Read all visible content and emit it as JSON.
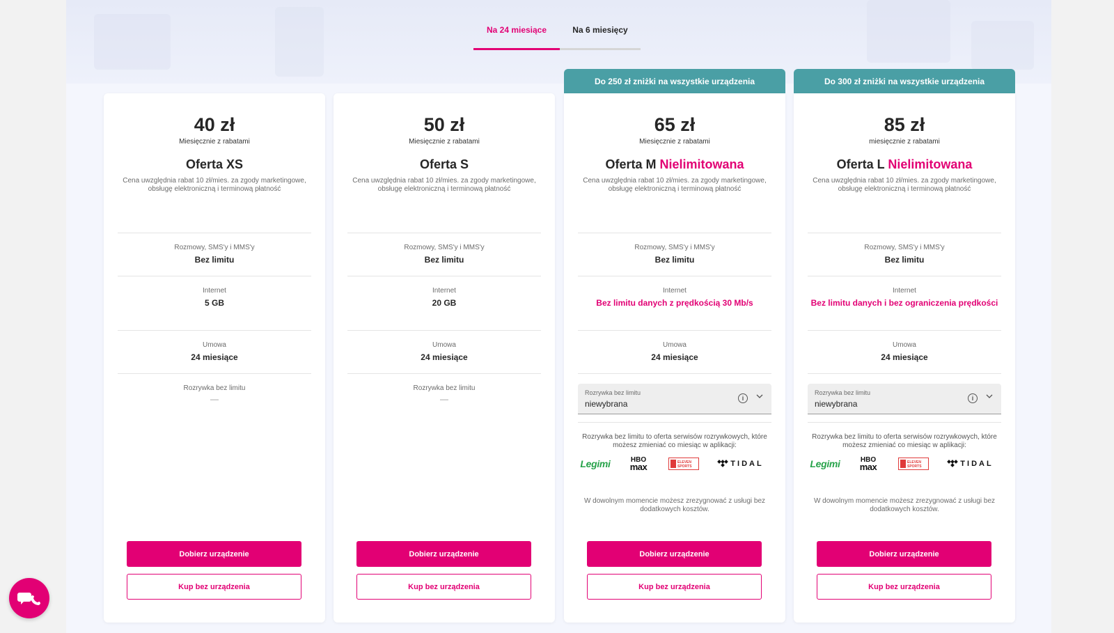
{
  "tabs": [
    {
      "label": "Na 24 miesiące",
      "active": true
    },
    {
      "label": "Na 6 miesięcy",
      "active": false
    }
  ],
  "colors": {
    "accent": "#e20074",
    "promo": "#4a9fa5"
  },
  "plans": [
    {
      "promo": "",
      "price": "40 zł",
      "price_sub": "Miesięcznie z rabatami",
      "name": "Oferta XS",
      "name_accent": "",
      "desc": "Cena uwzględnia rabat 10 zł/mies. za zgody marketingowe, obsługę elektroniczną i terminową płatność",
      "calls_label": "Rozmowy, SMS'y i MMS'y",
      "calls_value": "Bez limitu",
      "internet_label": "Internet",
      "internet_value": "5 GB",
      "contract_label": "Umowa",
      "contract_value": "24 miesiące",
      "entertainment_label": "Rozrywka bez limitu",
      "entertainment_value": "—",
      "primary_button": "Dobierz urządzenie",
      "secondary_button": "Kup bez urządzenia"
    },
    {
      "promo": "",
      "price": "50 zł",
      "price_sub": "Miesięcznie z rabatami",
      "name": "Oferta S",
      "name_accent": "",
      "desc": "Cena uwzględnia rabat 10 zł/mies. za zgody marketingowe, obsługę elektroniczną i terminową płatność",
      "calls_label": "Rozmowy, SMS'y i MMS'y",
      "calls_value": "Bez limitu",
      "internet_label": "Internet",
      "internet_value": "20 GB",
      "contract_label": "Umowa",
      "contract_value": "24 miesiące",
      "entertainment_label": "Rozrywka bez limitu",
      "entertainment_value": "—",
      "primary_button": "Dobierz urządzenie",
      "secondary_button": "Kup bez urządzenia"
    },
    {
      "promo": "Do 250 zł zniżki na wszystkie urządzenia",
      "price": "65 zł",
      "price_sub": "Miesięcznie z rabatami",
      "name": "Oferta M",
      "name_accent": "Nielimitowana",
      "desc": "Cena uwzględnia rabat 10 zł/mies. za zgody marketingowe, obsługę elektroniczną i terminową płatność",
      "calls_label": "Rozmowy, SMS'y i MMS'y",
      "calls_value": "Bez limitu",
      "internet_label": "Internet",
      "internet_value": "Bez limitu danych z prędkością 30 Mb/s",
      "contract_label": "Umowa",
      "contract_value": "24 miesiące",
      "select_label": "Rozrywka bez limitu",
      "select_value": "niewybrana",
      "ent_desc": "Rozrywka bez limitu to oferta serwisów rozrywkowych, które możesz zmieniać co miesiąc w aplikacji:",
      "logos": {
        "legimi": "Legimi",
        "hbo_top": "HBO",
        "hbo_bottom": "max",
        "eleven_top": "ELEVEN",
        "eleven_bottom": "SPORTS",
        "tidal": "TIDAL"
      },
      "cancel_note": "W dowolnym momencie możesz zrezygnować z usługi bez dodatkowych kosztów.",
      "primary_button": "Dobierz urządzenie",
      "secondary_button": "Kup bez urządzenia"
    },
    {
      "promo": "Do 300 zł zniżki na wszystkie urządzenia",
      "price": "85 zł",
      "price_sub": "miesięcznie z rabatami",
      "name": "Oferta L",
      "name_accent": "Nielimitowana",
      "desc": "Cena uwzględnia rabat 10 zł/mies. za zgody marketingowe, obsługę elektroniczną i terminową płatność",
      "calls_label": "Rozmowy, SMS'y i MMS'y",
      "calls_value": "Bez limitu",
      "internet_label": "Internet",
      "internet_value": "Bez limitu danych i bez ograniczenia prędkości",
      "contract_label": "Umowa",
      "contract_value": "24 miesiące",
      "select_label": "Rozrywka bez limitu",
      "select_value": "niewybrana",
      "ent_desc": "Rozrywka bez limitu to oferta serwisów rozrywkowych, które możesz zmieniać co miesiąc w aplikacji:",
      "logos": {
        "legimi": "Legimi",
        "hbo_top": "HBO",
        "hbo_bottom": "max",
        "eleven_top": "ELEVEN",
        "eleven_bottom": "SPORTS",
        "tidal": "TIDAL"
      },
      "cancel_note": "W dowolnym momencie możesz zrezygnować z usługi bez dodatkowych kosztów.",
      "primary_button": "Dobierz urządzenie",
      "secondary_button": "Kup bez urządzenia"
    }
  ],
  "chat": {
    "icon": "chat-phone-icon"
  }
}
